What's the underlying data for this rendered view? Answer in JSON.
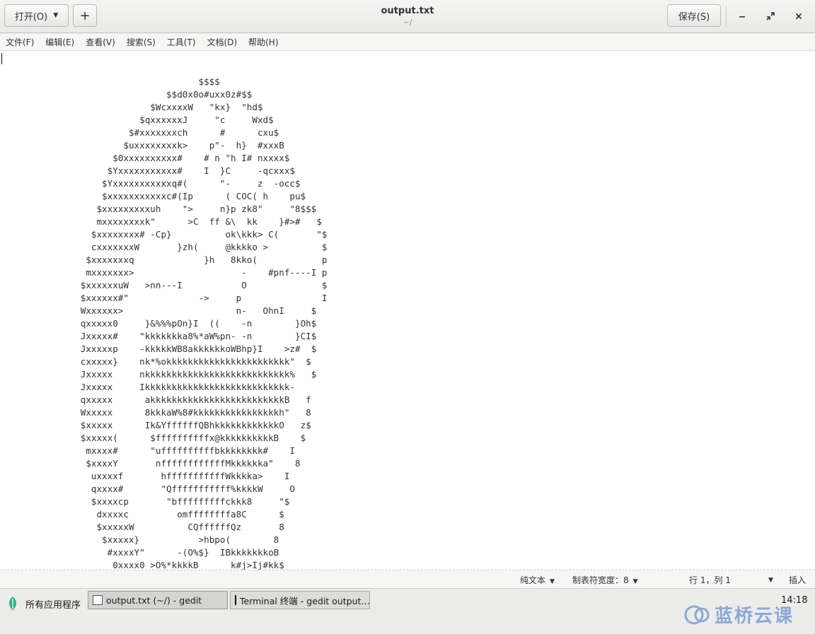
{
  "headerbar": {
    "open_label": "打开(O)",
    "new_tab_label": "+",
    "title": "output.txt",
    "subtitle": "~/",
    "save_label": "保存(S)"
  },
  "menubar": {
    "items": [
      "文件(F)",
      "编辑(E)",
      "查看(V)",
      "搜索(S)",
      "工具(T)",
      "文档(D)",
      "帮助(H)"
    ]
  },
  "editor": {
    "text": "                                     $$$$\n                               $$d0x0o#uxx0z#$$\n                            $WcxxxxW   \"kx}  \"hd$\n                          $qxxxxxxJ     \"c     Wxd$\n                        $#xxxxxxxch      #      cxu$\n                       $uxxxxxxxxk>    p\"-  h}  #xxxB\n                     $0xxxxxxxxxx#    # n \"h I# nxxxx$\n                    $Yxxxxxxxxxxx#    I  }C     -qcxxx$\n                   $Yxxxxxxxxxxxq#(      \"-     z  -occ$\n                   $xxxxxxxxxxxc#(Ip      ( COC( h    pu$\n                  $xxxxxxxxxuh    \">     n}p zk8\"     \"8$$$\n                  mxxxxxxxxk\"      >C  ff &\\  kk    }#>#   $\n                 $xxxxxxxx# -Cp}          ok\\kkk> C(       \"$\n                 cxxxxxxxW       }zh(     @kkkko >          $\n                $xxxxxxxq             }h   8kko(            p\n                mxxxxxxx>                    -    #pnf----I p\n               $xxxxxxuW   >nn---I           O              $\n               $xxxxxx#\"             ->     p               I\n               Wxxxxxx>                     n-   OhnI     $\n               qxxxxx0     }&%%%pOn}I  ((    -n        }Oh$\n               Jxxxxx#    \"kkkkkkka8%*aW%pn- -n        }CI$\n               Jxxxxxp    -kkkkkWB8akkkkkkoWBhp}I    >z#  $\n               cxxxxx}    nk*%okkkkkkkkkkkkkkkkkkkkkkk\"  $\n               Jxxxxx     nkkkkkkkkkkkkkkkkkkkkkkkkkkk%   $\n               Jxxxxx     Ikkkkkkkkkkkkkkkkkkkkkkkkkkk-\n               qxxxxx      akkkkkkkkkkkkkkkkkkkkkkkkkB   f\n               Wxxxxx      8kkkaW%8#kkkkkkkkkkkkkkkkh\"   8\n               $xxxxx      Ik&YffffffQBhkkkkkkkkkkkkO   z$\n               $xxxxx(      $ffffffffffx@kkkkkkkkkkB    $\n                mxxxx#      \"uffffffffffbkkkkkkkk#    I\n                $xxxxY       nffffffffffffMkkkkkka\"    8\n                 uxxxxf       hfffffffffffWkkkka>    I\n                 qxxxx#       \"Qfffffffffff%kkkkW     O\n                 $xxxxcp       \"bfffffffffckkk8     \"$\n                  dxxxxc         omffffffffa8C      $\n                  $xxxxxW          CQffffffQz       8\n                   $xxxxx}           >hbpo(        8\n                    #xxxxY\"      -(O%$}  IBkkkkkkkoB\n                     0xxxx0 >O%*kkkkB      k#j>Ij#kk$"
  },
  "statusbar": {
    "syntax": "纯文本",
    "tab_width": "制表符宽度：8",
    "position": "行 1，列 1",
    "mode": "插入"
  },
  "taskbar": {
    "apps_label": "所有应用程序",
    "tasks": [
      "output.txt (~/) - gedit",
      "Terminal 终端 - gedit output…"
    ],
    "clock": "14:18",
    "watermark": "蓝桥云课"
  }
}
